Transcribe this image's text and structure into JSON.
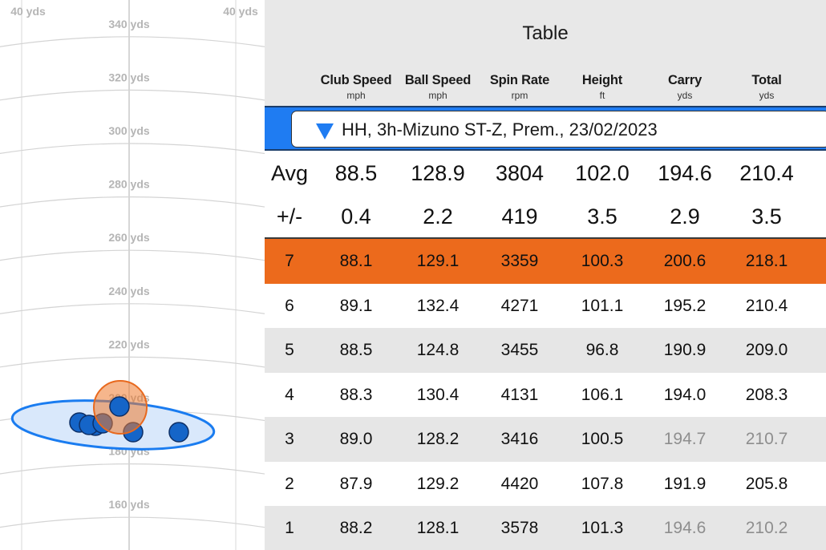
{
  "plot": {
    "lateral_labels": [
      "40 yds",
      "40 yds"
    ],
    "distance_labels": [
      "340 yds",
      "320 yds",
      "300 yds",
      "280 yds",
      "260 yds",
      "240 yds",
      "220 yds",
      "200 yds",
      "180 yds",
      "160 yds"
    ],
    "colors": {
      "shot": "#1565c8",
      "ellipse_stroke": "#1a7cf0",
      "ellipse_fill": "#d9e8fb",
      "selected": "#ef7a2e",
      "grid": "#d4d4d4"
    },
    "shots": [
      {
        "id": 7,
        "carry": 200.6,
        "lateral": 0
      },
      {
        "id": 6,
        "carry": 195.2,
        "lateral": -15
      },
      {
        "id": 5,
        "carry": 190.9,
        "lateral": -13
      },
      {
        "id": 4,
        "carry": 194.0,
        "lateral": -9
      },
      {
        "id": 3,
        "carry": 194.7,
        "lateral": -11
      },
      {
        "id": 2,
        "carry": 191.9,
        "lateral": 18
      },
      {
        "id": 1,
        "carry": 194.6,
        "lateral": 2
      }
    ]
  },
  "table": {
    "title": "Table",
    "columns": [
      {
        "name": "Club Speed",
        "unit": "mph"
      },
      {
        "name": "Ball Speed",
        "unit": "mph"
      },
      {
        "name": "Spin Rate",
        "unit": "rpm"
      },
      {
        "name": "Height",
        "unit": "ft"
      },
      {
        "name": "Carry",
        "unit": "yds"
      },
      {
        "name": "Total",
        "unit": "yds"
      }
    ],
    "session": "HH, 3h-Mizuno ST-Z, Prem., 23/02/2023",
    "avg": {
      "label": "Avg",
      "values": [
        "88.5",
        "128.9",
        "3804",
        "102.0",
        "194.6",
        "210.4"
      ]
    },
    "dev": {
      "label": "+/-",
      "values": [
        "0.4",
        "2.2",
        "419",
        "3.5",
        "2.9",
        "3.5"
      ]
    },
    "rows": [
      {
        "shot": "7",
        "values": [
          "88.1",
          "129.1",
          "3359",
          "100.3",
          "200.6",
          "218.1"
        ],
        "selected": true,
        "dimmed": []
      },
      {
        "shot": "6",
        "values": [
          "89.1",
          "132.4",
          "4271",
          "101.1",
          "195.2",
          "210.4"
        ],
        "selected": false,
        "dimmed": []
      },
      {
        "shot": "5",
        "values": [
          "88.5",
          "124.8",
          "3455",
          "96.8",
          "190.9",
          "209.0"
        ],
        "selected": false,
        "dimmed": []
      },
      {
        "shot": "4",
        "values": [
          "88.3",
          "130.4",
          "4131",
          "106.1",
          "194.0",
          "208.3"
        ],
        "selected": false,
        "dimmed": []
      },
      {
        "shot": "3",
        "values": [
          "89.0",
          "128.2",
          "3416",
          "100.5",
          "194.7",
          "210.7"
        ],
        "selected": false,
        "dimmed": [
          4,
          5
        ]
      },
      {
        "shot": "2",
        "values": [
          "87.9",
          "129.2",
          "4420",
          "107.8",
          "191.9",
          "205.8"
        ],
        "selected": false,
        "dimmed": []
      },
      {
        "shot": "1",
        "values": [
          "88.2",
          "128.1",
          "3578",
          "101.3",
          "194.6",
          "210.2"
        ],
        "selected": false,
        "dimmed": [
          4,
          5
        ]
      }
    ]
  }
}
